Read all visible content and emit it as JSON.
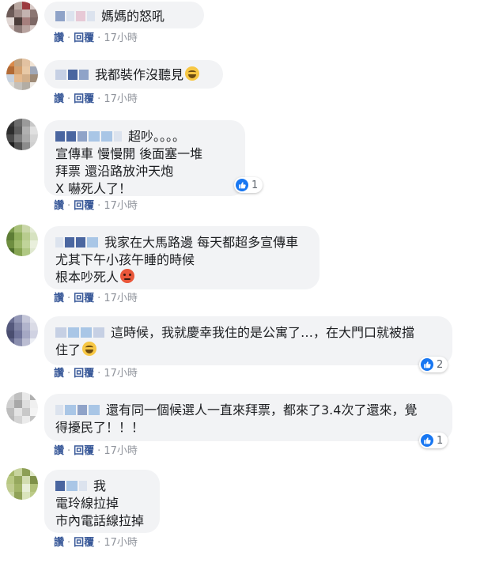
{
  "actions": {
    "like": "讚",
    "reply": "回覆",
    "separator": "·"
  },
  "comments": [
    {
      "lines": [
        "媽媽的怒吼"
      ],
      "time": "17小時",
      "avatar_colors": [
        "#5a4844",
        "#b9a7a0",
        "#9c3b3f",
        "#d7c9c6",
        "#6d5b58",
        "#a08c88",
        "#c3b3b0",
        "#8b7672",
        "#e0d6d3",
        "#4c3d3a",
        "#a57f7d",
        "#7d6865",
        "#cbbab6",
        "#8f7c79",
        "#b8a39f",
        "#d9ccc9"
      ]
    },
    {
      "lines": [
        "我都裝作沒聽見"
      ],
      "emoji": "grinning-sweat",
      "time": "17小時",
      "avatar_colors": [
        "#d98a4a",
        "#c1a27f",
        "#e2c2a1",
        "#f0e3d4",
        "#b36b35",
        "#d4a06e",
        "#e8c9a6",
        "#a0a8b8",
        "#c7d1dd",
        "#e4b98e",
        "#d2af8a",
        "#9e8a76",
        "#dcdad5",
        "#c4c0ba",
        "#b3ada4",
        "#eeeae5"
      ]
    },
    {
      "lines": [
        "超吵。。。。",
        "宣傳車 慢慢開 後面塞一堆",
        "拜票 還沿路放沖天炮",
        "X 嚇死人了！"
      ],
      "time": "17小時",
      "reaction_count": "1",
      "avatar_colors": [
        "#3a3a3a",
        "#6b6b6b",
        "#9a9a9a",
        "#c8c8c8",
        "#2d2d2d",
        "#5e5e5e",
        "#b0b0b0",
        "#e0e0e0",
        "#4a4a4a",
        "#7e7e7e",
        "#a8a8a8",
        "#d4d4d4",
        "#1f1f1f",
        "#505050",
        "#8c8c8c",
        "#cfcfcf"
      ]
    },
    {
      "lines": [
        "我家在大馬路邊 每天都超多宣傳車",
        "尤其下午小孩午睡的時候",
        "根本吵死人"
      ],
      "emoji": "angry",
      "time": "17小時",
      "avatar_colors": [
        "#7a9a4a",
        "#a8c07a",
        "#c9d6a8",
        "#e2ead3",
        "#5d7d35",
        "#8fae5c",
        "#b8cc8e",
        "#d6e2c0",
        "#6e8e40",
        "#9cb86a",
        "#c0d49a",
        "#e9efdc",
        "#4f6f2c",
        "#86a452",
        "#b0c884",
        "#dfe8cf"
      ]
    },
    {
      "lines": [
        "這時候，我就慶幸我住的是公寓了…，在大門口就被擋",
        "住了"
      ],
      "emoji": "grinning-sweat",
      "time": "17小時",
      "reaction_count": "2",
      "avatar_colors": [
        "#6a6e92",
        "#9397b6",
        "#c4c6d8",
        "#e4e5ee",
        "#55597d",
        "#7f83a4",
        "#b1b4cc",
        "#dadbe6",
        "#4a4e70",
        "#70749a",
        "#a5a8c4",
        "#d0d2e2",
        "#5f6388",
        "#8a8eae",
        "#bbbdd2",
        "#eceef4"
      ]
    },
    {
      "lines": [
        "還有同一個候選人一直來拜票，都來了3.4次了還來，覺",
        "得擾民了！！！"
      ],
      "time": "17小時",
      "reaction_count": "1",
      "avatar_colors": [
        "#d8d8d8",
        "#c0c0c0",
        "#e8e8e8",
        "#b0b0b0",
        "#cfcfcf",
        "#a8a8a8",
        "#dedede",
        "#f0f0f0",
        "#bdbdbd",
        "#e3e3e3",
        "#c8c8c8",
        "#f4f4f4",
        "#b8b8b8",
        "#d4d4d4",
        "#ebebeb",
        "#c4c4c4"
      ]
    },
    {
      "lines": [
        "我",
        "電玲線拉掉",
        "市內電話線拉掉"
      ],
      "time": "17小時",
      "avatar_colors": [
        "#a6b86a",
        "#c8d49e",
        "#8d9f55",
        "#e0e8c8",
        "#b8c882",
        "#96a85e",
        "#d2dcb0",
        "#7e9048",
        "#c0cc90",
        "#a2b468",
        "#e8eed8",
        "#b0c078",
        "#cad6a4",
        "#90a258",
        "#dae4bc",
        "#bccb88"
      ]
    }
  ]
}
